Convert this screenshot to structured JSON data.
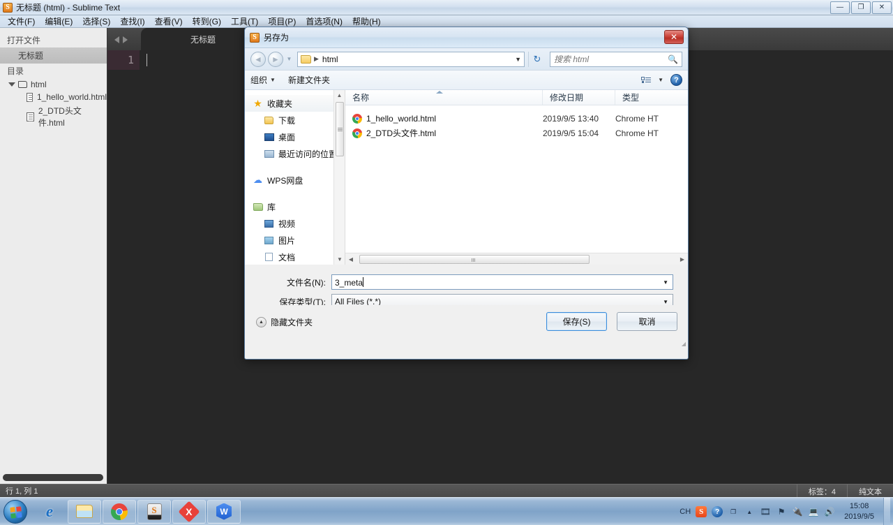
{
  "sublime": {
    "title": "无标题 (html) - Sublime Text",
    "app_icon": "S",
    "window_controls": {
      "minimize": "—",
      "restore": "❐",
      "close": "✕"
    },
    "menu": [
      "文件(F)",
      "编辑(E)",
      "选择(S)",
      "查找(I)",
      "查看(V)",
      "转到(G)",
      "工具(T)",
      "项目(P)",
      "首选项(N)",
      "帮助(H)"
    ],
    "sidebar": {
      "open_files_header": "打开文件",
      "open_file": "无标题",
      "folders_header": "目录",
      "root_folder": "html",
      "files": [
        "1_hello_world.html",
        "2_DTD头文件.html"
      ]
    },
    "tab": {
      "label": "无标题",
      "close": "×"
    },
    "editor": {
      "line_number": "1"
    },
    "status": {
      "cursor": "行 1, 列 1",
      "tab_size": "标签：4",
      "syntax": "纯文本"
    }
  },
  "dialog": {
    "title": "另存为",
    "icon": "S",
    "close": "✕",
    "nav": {
      "back": "◄",
      "forward": "►",
      "history_caret": "▼",
      "breadcrumb": "html",
      "breadcrumb_sep": "▶",
      "address_caret": "▼",
      "refresh": "↻",
      "search_placeholder": "搜索 html",
      "search_icon": "search-icon"
    },
    "toolbar": {
      "organize": "组织",
      "organize_caret": "▼",
      "new_folder": "新建文件夹",
      "view_caret": "▼",
      "help": "?"
    },
    "places": [
      {
        "label": "收藏夹",
        "icon": "star-icon",
        "level": 0,
        "selected": true
      },
      {
        "label": "下载",
        "icon": "folder-icon",
        "level": 1,
        "selected": false
      },
      {
        "label": "桌面",
        "icon": "desktop-icon",
        "level": 1,
        "selected": false
      },
      {
        "label": "最近访问的位置",
        "icon": "recent-icon",
        "level": 1,
        "selected": false
      },
      {
        "label": "WPS网盘",
        "icon": "cloud-icon",
        "level": 0,
        "selected": false
      },
      {
        "label": "库",
        "icon": "library-icon",
        "level": 0,
        "selected": false
      },
      {
        "label": "视频",
        "icon": "video-icon",
        "level": 1,
        "selected": false
      },
      {
        "label": "图片",
        "icon": "picture-icon",
        "level": 1,
        "selected": false
      },
      {
        "label": "文档",
        "icon": "document-icon",
        "level": 1,
        "selected": false
      }
    ],
    "file_list": {
      "columns": [
        "名称",
        "修改日期",
        "类型"
      ],
      "rows": [
        {
          "name": "1_hello_world.html",
          "date": "2019/9/5 13:40",
          "type": "Chrome HT"
        },
        {
          "name": "2_DTD头文件.html",
          "date": "2019/9/5 15:04",
          "type": "Chrome HT"
        }
      ]
    },
    "form": {
      "filename_label": "文件名(N):",
      "filename_value": "3_meta",
      "savetype_label": "保存类型(T):",
      "savetype_value": "All Files (*.*)",
      "caret": "▼"
    },
    "footer": {
      "hide_folders": "隐藏文件夹",
      "hide_folders_icon": "▲",
      "save_button": "保存(S)",
      "cancel_button": "取消"
    }
  },
  "taskbar": {
    "start": "start-orb",
    "apps": [
      {
        "name": "internet-explorer",
        "glyph": "e"
      },
      {
        "name": "file-explorer",
        "glyph": ""
      },
      {
        "name": "google-chrome",
        "glyph": ""
      },
      {
        "name": "sublime-text",
        "glyph": "S"
      },
      {
        "name": "xmind",
        "glyph": "X"
      },
      {
        "name": "wps-office",
        "glyph": "W"
      }
    ],
    "tray": {
      "input_method": "CH",
      "sogou": "S",
      "help": "?",
      "expand": "▲",
      "icons": [
        "film-icon",
        "flag-error-icon",
        "usb-icon",
        "network-icon",
        "volume-icon"
      ]
    },
    "clock_time": "15:08",
    "clock_date": "2019/9/5"
  }
}
